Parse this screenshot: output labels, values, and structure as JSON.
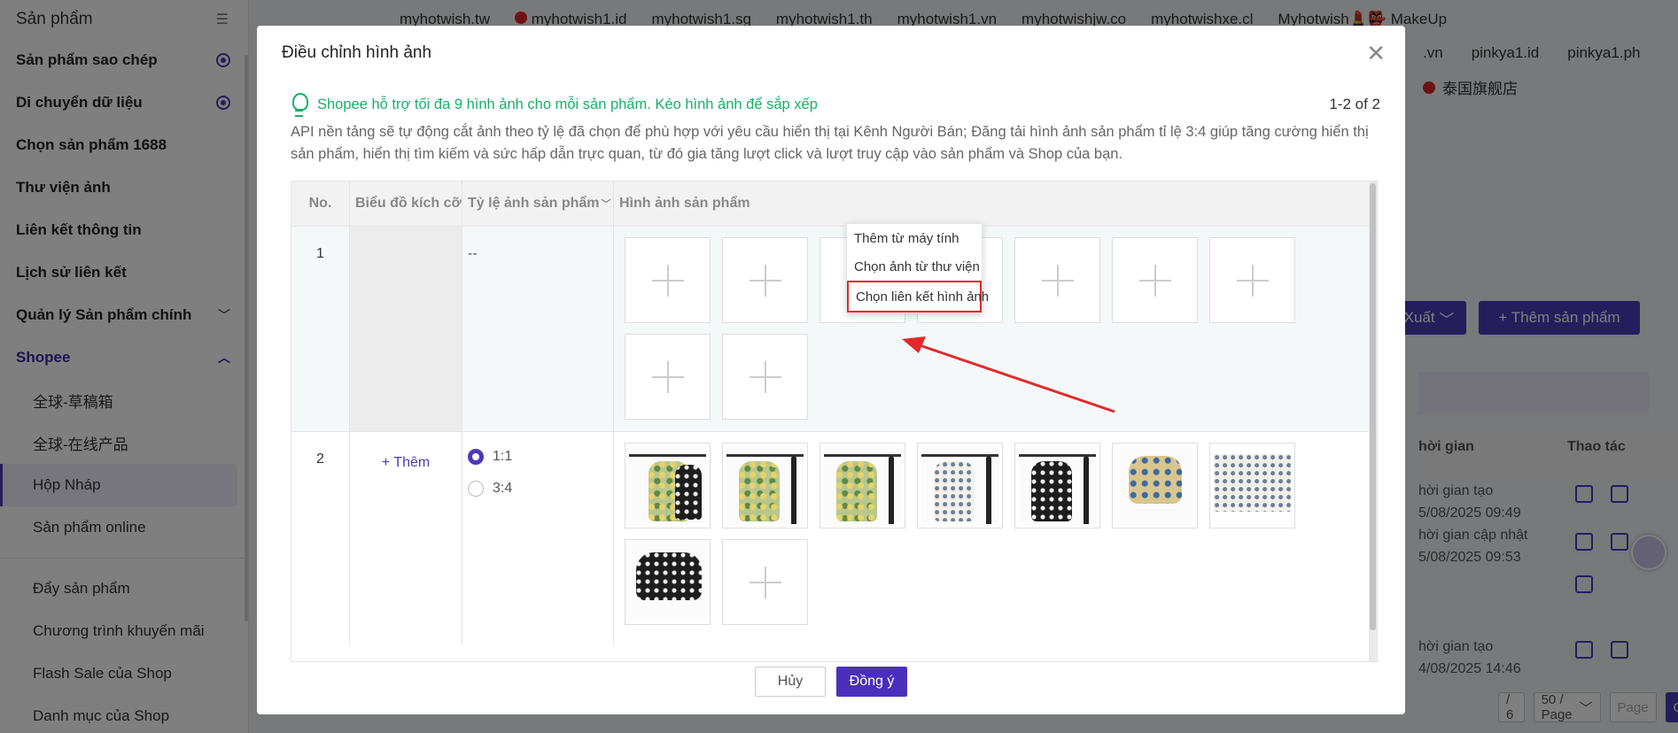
{
  "sidebar": {
    "title": "Sản phẩm",
    "items": [
      {
        "label": "Sản phẩm sao chép",
        "icon": "gear-icon"
      },
      {
        "label": "Di chuyển dữ liệu",
        "icon": "gear-icon"
      },
      {
        "label": "Chọn sản phẩm 1688"
      },
      {
        "label": "Thư viện ảnh"
      },
      {
        "label": "Liên kết thông tin"
      },
      {
        "label": "Lịch sử liên kết"
      },
      {
        "label": "Quản lý Sản phẩm chính",
        "icon": "chevron-down-icon"
      },
      {
        "label": "Shopee",
        "icon": "chevron-up-icon"
      }
    ],
    "subitems": [
      "全球-草稿箱",
      "全球-在线产品",
      "Hộp Nháp",
      "Sản phẩm online"
    ],
    "lower": [
      "Đẩy sản phẩm",
      "Chương trình khuyến mãi",
      "Flash Sale của Shop",
      "Danh mục của Shop"
    ]
  },
  "background": {
    "shops_row1": [
      "myhotwish.tw",
      "myhotwish1.id",
      "myhotwish1.sg",
      "myhotwish1.th",
      "myhotwish1.vn",
      "myhotwishjw.co",
      "myhotwishxe.cl",
      "Myhotwish💄👺 MakeUp"
    ],
    "shops_row2": [
      ".vn",
      "pinkya1.id",
      "pinkya1.ph"
    ],
    "shop_row3": "泰国旗舰店",
    "export_button": "Xuất",
    "add_product_button": "+ Thêm sản phẩm",
    "col_time": "hời gian",
    "col_actions": "Thao tác",
    "time_lines": [
      "hời gian tạo",
      "5/08/2025 09:49",
      "hời gian cập nhật",
      "5/08/2025 09:53",
      "hời gian tạo",
      "4/08/2025 14:46"
    ],
    "pager": {
      "pages": "/ 6",
      "page_size": "50 / Page",
      "page_placeholder": "Page",
      "go": "Go"
    }
  },
  "modal": {
    "title": "Điều chỉnh hình ảnh",
    "tip_title": "Shopee hỗ trợ tối đa 9 hình ảnh cho mỗi sản phẩm. Kéo hình ảnh để sắp xếp",
    "tip_desc": "API nền tảng sẽ tự động cắt ảnh theo tỷ lệ đã chọn để phù hợp với yêu cầu hiển thị tại Kênh Người Bán; Đăng tải hình ảnh sản phẩm tỉ lệ 3:4 giúp tăng cường hiển thị sản phẩm, hiển thị tìm kiếm và sức hấp dẫn trực quan, từ đó gia tăng lượt click và lượt truy cập vào sản phẩm và Shop của bạn.",
    "page_count": "1-2 of 2",
    "columns": [
      "No.",
      "Biểu đồ kích cỡ",
      "Tỷ lệ ảnh sản phẩm",
      "Hình ảnh sản phẩm"
    ],
    "rows": [
      {
        "no": "1",
        "ratio": "--",
        "empty_slots": 9
      },
      {
        "no": "2",
        "size_chart_action": "+ Thêm",
        "ratio_options": [
          "1:1",
          "3:4"
        ],
        "ratio_selected": "1:1",
        "images": 8
      }
    ],
    "dropdown": [
      "Thêm từ máy tính",
      "Chọn ảnh từ thư viện",
      "Chọn liên kết hình ảnh"
    ],
    "cancel": "Hủy",
    "confirm": "Đồng ý"
  }
}
